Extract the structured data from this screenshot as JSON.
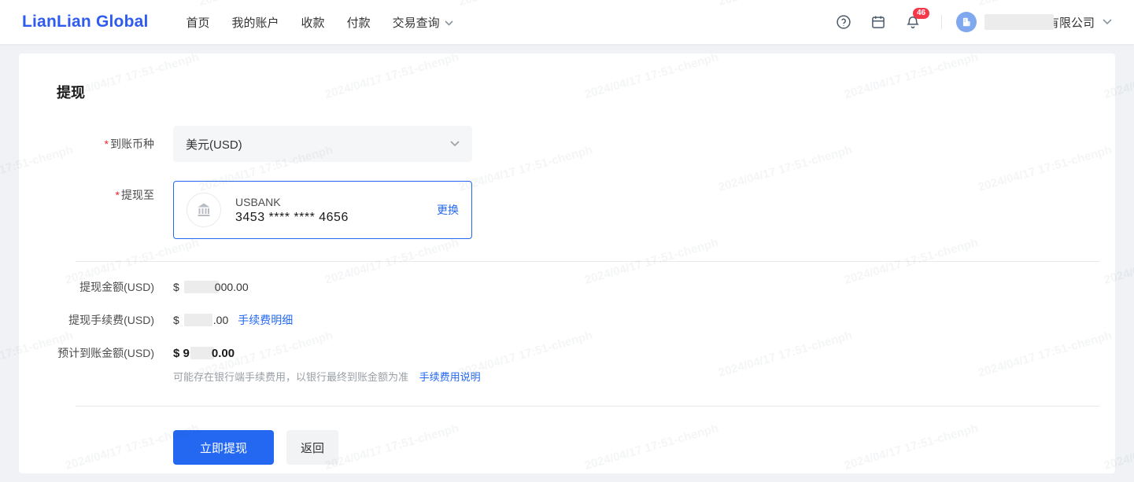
{
  "header": {
    "logo": "LianLian Global",
    "nav": [
      {
        "label": "首页"
      },
      {
        "label": "我的账户"
      },
      {
        "label": "收款"
      },
      {
        "label": "付款"
      },
      {
        "label": "交易查询",
        "has_dropdown": true
      }
    ],
    "notification_count": "46",
    "company_suffix": "有限公司"
  },
  "page": {
    "title": "提现",
    "currency_field": {
      "label": "到账币种",
      "value": "美元(USD)"
    },
    "withdraw_to_field": {
      "label": "提现至",
      "bank_name": "USBANK",
      "account_masked": "3453 **** **** 4656",
      "change_label": "更换"
    },
    "amounts": {
      "withdraw": {
        "label": "提现金额(USD)",
        "prefix": "$",
        "visible_suffix": "000.00"
      },
      "fee": {
        "label": "提现手续费(USD)",
        "prefix": "$",
        "visible_suffix": ".00",
        "link": "手续费明细"
      },
      "estimated": {
        "label": "预计到账金额(USD)",
        "prefix": "$ 9",
        "visible_suffix": "0.00"
      }
    },
    "note": "可能存在银行端手续费用，以银行最终到账金额为准",
    "note_link": "手续费用说明",
    "buttons": {
      "submit": "立即提现",
      "back": "返回"
    }
  },
  "watermark": "2024/04/17 17:51-chenph",
  "colors": {
    "brand_blue": "#2e5bf0",
    "link_blue": "#2468f2",
    "badge_red": "#f5394b",
    "page_bg": "#f0f2f5",
    "field_bg": "#f5f6f7",
    "divider": "#e9e9e9"
  }
}
